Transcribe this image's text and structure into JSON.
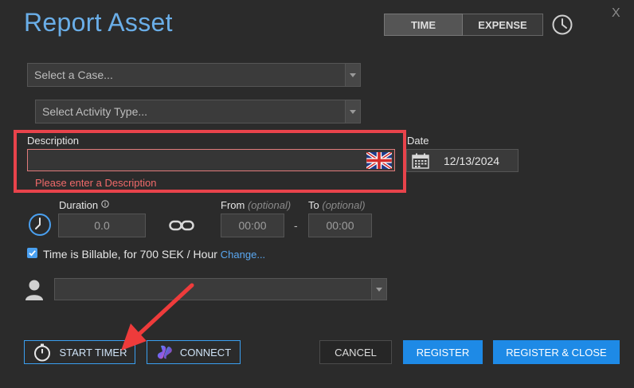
{
  "title": "Report Asset",
  "close_label": "X",
  "tabs": {
    "time": "TIME",
    "expense": "EXPENSE"
  },
  "case": {
    "placeholder": "Select a Case..."
  },
  "activity": {
    "placeholder": "Select Activity Type..."
  },
  "description": {
    "label": "Description",
    "value": "",
    "error": "Please enter a Description"
  },
  "date": {
    "label": "Date",
    "value": "12/13/2024"
  },
  "duration": {
    "label": "Duration",
    "value": "0.0"
  },
  "from": {
    "label": "From",
    "optional": "(optional)",
    "value": "00:00"
  },
  "dash": "-",
  "to": {
    "label": "To",
    "optional": "(optional)",
    "value": "00:00"
  },
  "billable": {
    "text": "Time is Billable, for 700 SEK / Hour",
    "change": "Change...",
    "checked": true
  },
  "buttons": {
    "start_timer": "START TIMER",
    "connect": "CONNECT",
    "cancel": "CANCEL",
    "register": "REGISTER",
    "register_close": "REGISTER & CLOSE"
  },
  "colors": {
    "accent": "#1e8ae6",
    "error": "#e8434b",
    "title": "#6aaee8"
  }
}
